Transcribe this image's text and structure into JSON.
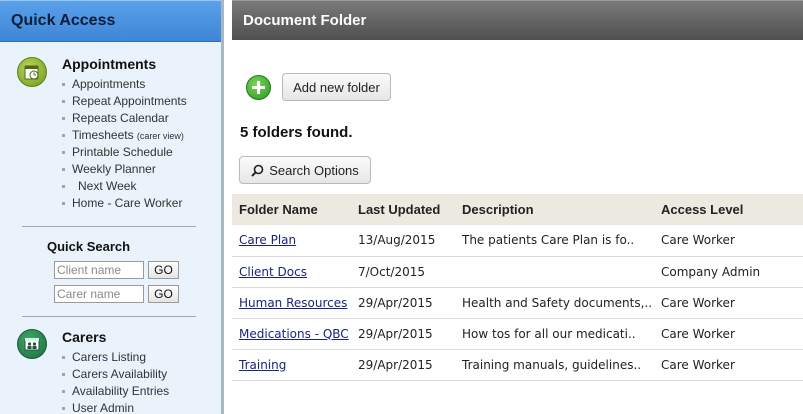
{
  "sidebar": {
    "header": "Quick Access",
    "appointments": {
      "icon": "calendar-clock-icon",
      "title": "Appointments",
      "items": [
        {
          "label": "Appointments",
          "note": ""
        },
        {
          "label": "Repeat Appointments",
          "note": ""
        },
        {
          "label": "Repeats Calendar",
          "note": ""
        },
        {
          "label": "Timesheets",
          "note": "(carer view)"
        },
        {
          "label": "Printable Schedule",
          "note": ""
        },
        {
          "label": "Weekly Planner",
          "note": ""
        },
        {
          "label": "Next Week",
          "note": ""
        },
        {
          "label": "Home - Care Worker",
          "note": ""
        }
      ]
    },
    "quick_search": {
      "title": "Quick Search",
      "client_placeholder": "Client name",
      "carer_placeholder": "Carer name",
      "go_label": "GO"
    },
    "carers": {
      "icon": "carers-icon",
      "title": "Carers",
      "items": [
        "Carers Listing",
        "Carers Availability",
        "Availability Entries",
        "User Admin"
      ]
    }
  },
  "main": {
    "title": "Document Folder",
    "add_folder_label": "Add new folder",
    "add_icon": "plus-circle-icon",
    "found_text": "5 folders found.",
    "search_options_label": "Search Options",
    "search_icon": "magnifier-icon",
    "columns": [
      "Folder Name",
      "Last Updated",
      "Description",
      "Access Level"
    ],
    "rows": [
      {
        "name": "Care Plan",
        "updated": "13/Aug/2015",
        "description": "The patients Care Plan is fo..",
        "access": "Care Worker"
      },
      {
        "name": "Client Docs",
        "updated": "7/Oct/2015",
        "description": "",
        "access": "Company Admin"
      },
      {
        "name": "Human Resources",
        "updated": "29/Apr/2015",
        "description": "Health and Safety documents,..",
        "access": "Care Worker"
      },
      {
        "name": "Medications - QBC",
        "updated": "29/Apr/2015",
        "description": "How tos for all our medicati..",
        "access": "Care Worker"
      },
      {
        "name": "Training",
        "updated": "29/Apr/2015",
        "description": "Training manuals, guidelines..",
        "access": "Care Worker"
      }
    ]
  },
  "colors": {
    "sidebar_bg": "#eaf2fb",
    "sidebar_header": "#4a93e0",
    "main_header": "#5e5e5e",
    "table_header_bg": "#eceae0",
    "link": "#1a237e"
  }
}
